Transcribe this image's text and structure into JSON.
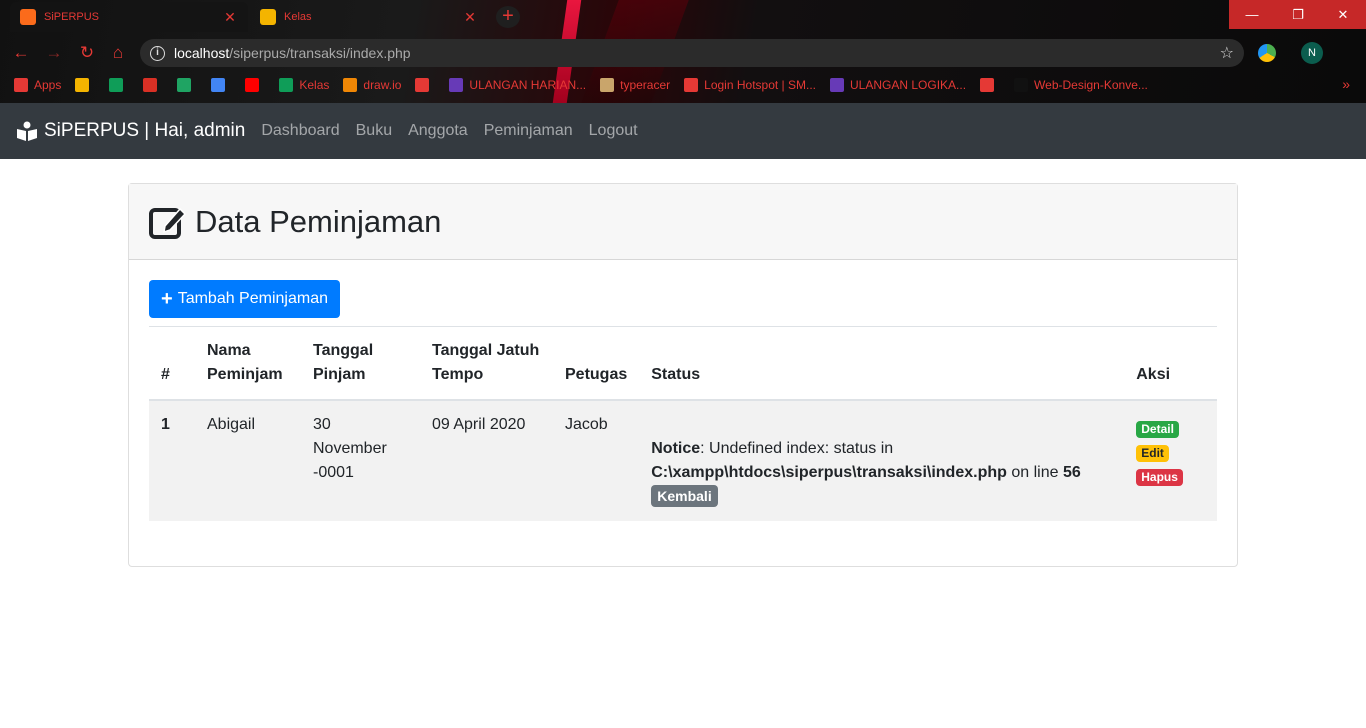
{
  "browser": {
    "tabs": [
      {
        "title": "SiPERPUS",
        "active": true,
        "favicon_color": "#fb6b1b"
      },
      {
        "title": "Kelas",
        "active": false,
        "favicon_color": "#f4b400"
      }
    ],
    "url_host": "localhost",
    "url_path": "/siperpus/transaksi/index.php",
    "profile_initial": "N",
    "bookmarks": [
      {
        "label": "Apps",
        "icon": "apps-grid-icon",
        "color": "#e53935"
      },
      {
        "label": "",
        "icon": "slides-icon",
        "color": "#f4b400"
      },
      {
        "label": "",
        "icon": "classroom-icon",
        "color": "#0f9d58"
      },
      {
        "label": "",
        "icon": "gmail-icon",
        "color": "#d93025"
      },
      {
        "label": "",
        "icon": "drive-icon",
        "color": "#1fa463"
      },
      {
        "label": "",
        "icon": "docs-icon",
        "color": "#4285f4"
      },
      {
        "label": "",
        "icon": "youtube-icon",
        "color": "#ff0000"
      },
      {
        "label": "Kelas",
        "icon": "classroom-icon",
        "color": "#0f9d58"
      },
      {
        "label": "draw.io",
        "icon": "drawio-icon",
        "color": "#f08705"
      },
      {
        "label": "",
        "icon": "globe-icon",
        "color": "#e53935"
      },
      {
        "label": "ULANGAN HARIAN...",
        "icon": "forms-icon",
        "color": "#673ab7"
      },
      {
        "label": "typeracer",
        "icon": "typeracer-icon",
        "color": "#c9a56b"
      },
      {
        "label": "Login Hotspot | SM...",
        "icon": "globe-icon",
        "color": "#e53935"
      },
      {
        "label": "ULANGAN LOGIKA...",
        "icon": "forms-icon",
        "color": "#673ab7"
      },
      {
        "label": "",
        "icon": "globe-icon",
        "color": "#e53935"
      },
      {
        "label": "Web-Design-Konve...",
        "icon": "github-icon",
        "color": "#111111"
      }
    ]
  },
  "navbar": {
    "brand": "SiPERPUS | Hai, admin",
    "links": [
      "Dashboard",
      "Buku",
      "Anggota",
      "Peminjaman",
      "Logout"
    ]
  },
  "page": {
    "title": "Data Peminjaman",
    "add_button": "Tambah Peminjaman"
  },
  "table": {
    "headers": [
      "#",
      "Nama Peminjam",
      "Tanggal Pinjam",
      "Tanggal Jatuh Tempo",
      "Petugas",
      "Status",
      "Aksi"
    ],
    "rows": [
      {
        "no": "1",
        "nama": "Abigail",
        "tgl_pinjam": "30 November -0001",
        "tgl_tempo": "09 April 2020",
        "petugas": "Jacob",
        "notice_label": "Notice",
        "notice_text": ": Undefined index: status in",
        "notice_path": "C:\\xampp\\htdocs\\siperpus\\transaksi\\index.php",
        "notice_online": " on line ",
        "notice_line": "56",
        "status_badge": "Kembali",
        "actions": {
          "detail": "Detail",
          "edit": "Edit",
          "hapus": "Hapus"
        }
      }
    ]
  },
  "colors": {
    "primary": "#007bff",
    "navbar_bg": "#343a40",
    "success": "#28a745",
    "warning": "#ffc107",
    "danger": "#dc3545",
    "secondary": "#6c757d"
  }
}
